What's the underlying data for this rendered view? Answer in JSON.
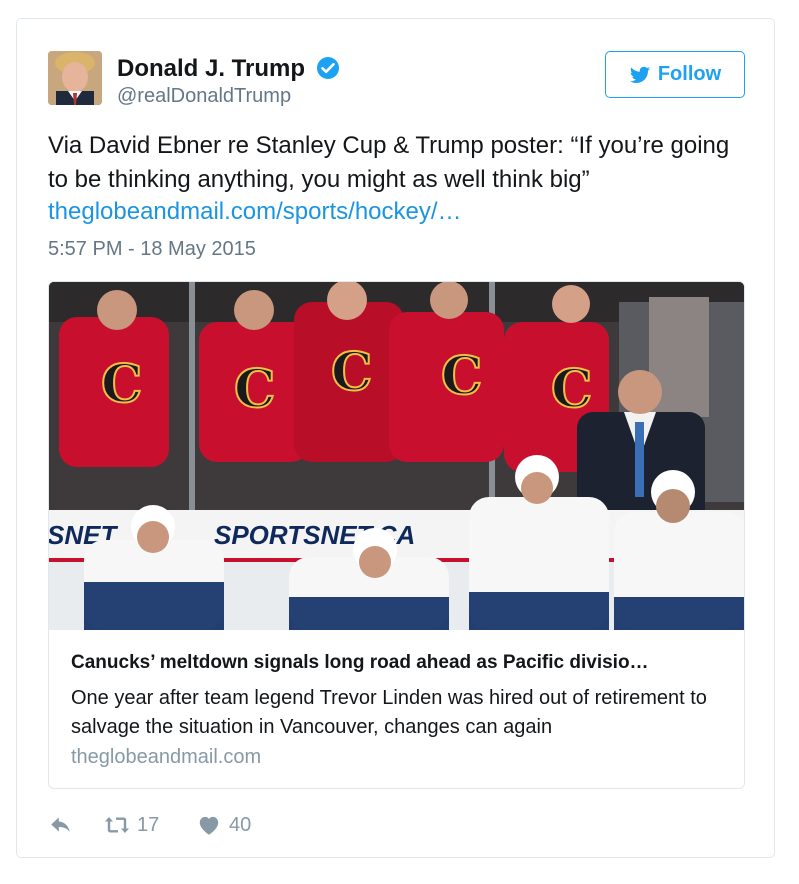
{
  "author": {
    "name": "Donald J. Trump",
    "handle": "@realDonaldTrump",
    "avatar_icon": "profile-photo"
  },
  "follow_label": "Follow",
  "tweet": {
    "text": "Via David Ebner re Stanley Cup & Trump poster: “If you’re going to be thinking anything, you might as well think big”",
    "link": "theglobeandmail.com/sports/hockey/…",
    "timestamp": "5:57 PM - 18 May 2015"
  },
  "card": {
    "image_signs": [
      "SNET",
      "SPORTSNET.CA"
    ],
    "title": "Canucks’ meltdown signals long road ahead as Pacific divisio…",
    "description": "One year after team legend Trevor Linden was hired out of retirement to salvage the situation in Vancouver, changes can again",
    "domain": "theglobeandmail.com"
  },
  "actions": {
    "retweet_count": "17",
    "like_count": "40"
  },
  "colors": {
    "twitter_blue": "#1da1f2",
    "link_blue": "#1b95e0",
    "muted_gray": "#657786",
    "flames_red": "#c8102e",
    "canucks_blue": "#00205b"
  }
}
